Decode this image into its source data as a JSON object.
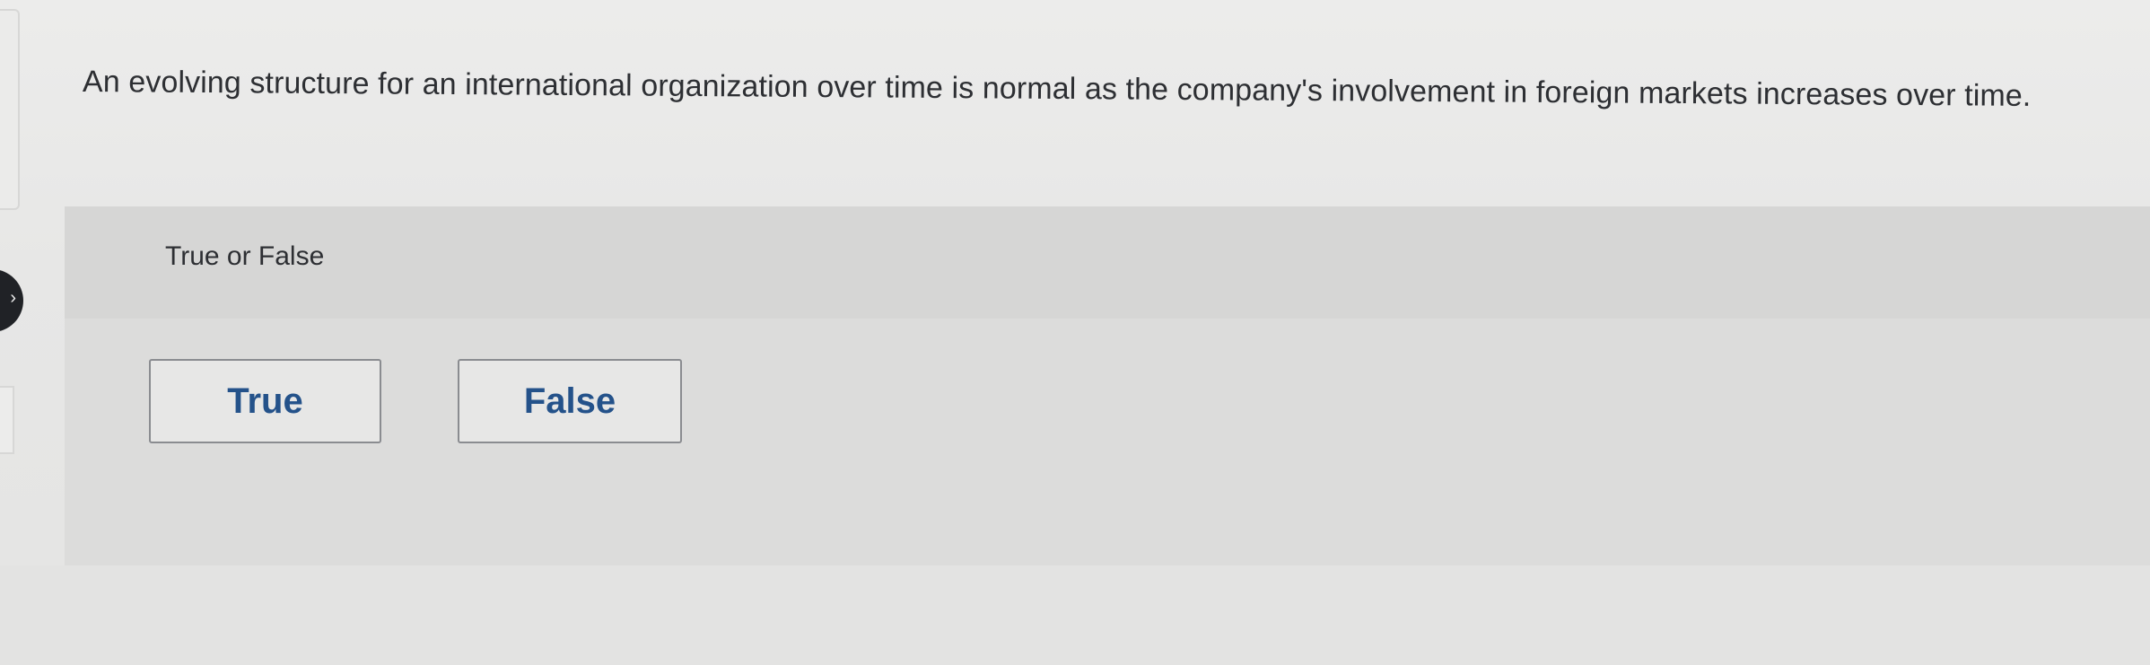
{
  "question": {
    "text": "An evolving structure for an international organization over time is normal as the company's involvement in foreign markets increases over time."
  },
  "answer_panel": {
    "prompt": "True or False",
    "choices": [
      {
        "label": "True"
      },
      {
        "label": "False"
      }
    ]
  },
  "icons": {
    "left_navigation": "chevron-right-icon"
  },
  "colors": {
    "text": "#2d2f33",
    "button_text": "#24528a",
    "panel_background": "#dcdcdb",
    "page_background": "#e9e9e8"
  }
}
